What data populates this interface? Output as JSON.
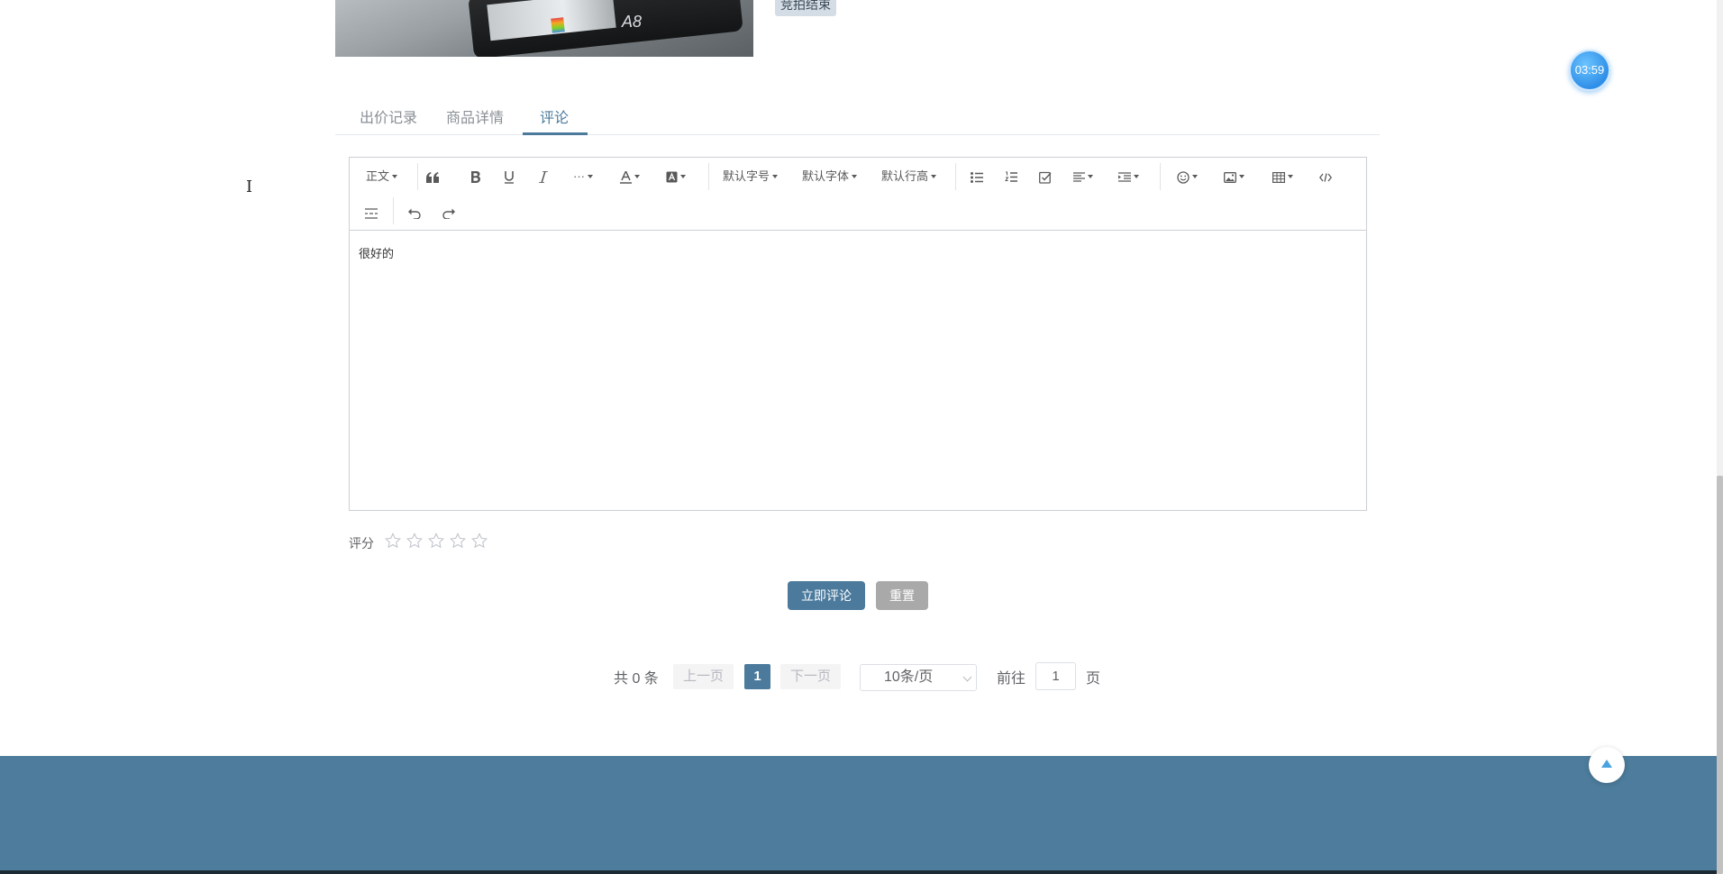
{
  "auction": {
    "status_tag": "竞拍结束",
    "timer": "03:59"
  },
  "tabs": [
    {
      "label": "出价记录"
    },
    {
      "label": "商品详情"
    },
    {
      "label": "评论"
    }
  ],
  "active_tab": "评论",
  "editor": {
    "toolbar": {
      "heading": "正文",
      "font_size": "默认字号",
      "font_family": "默认字体",
      "line_height": "默认行高",
      "more": "···"
    },
    "content": "很好的"
  },
  "rating": {
    "label": "评分",
    "max": 5,
    "value": 0
  },
  "actions": {
    "submit": "立即评论",
    "reset": "重置"
  },
  "pagination": {
    "total": "共 0 条",
    "prev": "上一页",
    "current": "1",
    "next": "下一页",
    "page_size": "10条/页",
    "goto_label": "前往",
    "goto_value": "1",
    "goto_unit": "页"
  },
  "colors": {
    "accent": "#4b7a9c",
    "footer": "#4d7c9c",
    "timer": "#2f8fe8",
    "reset_button": "#a9a9a9"
  }
}
